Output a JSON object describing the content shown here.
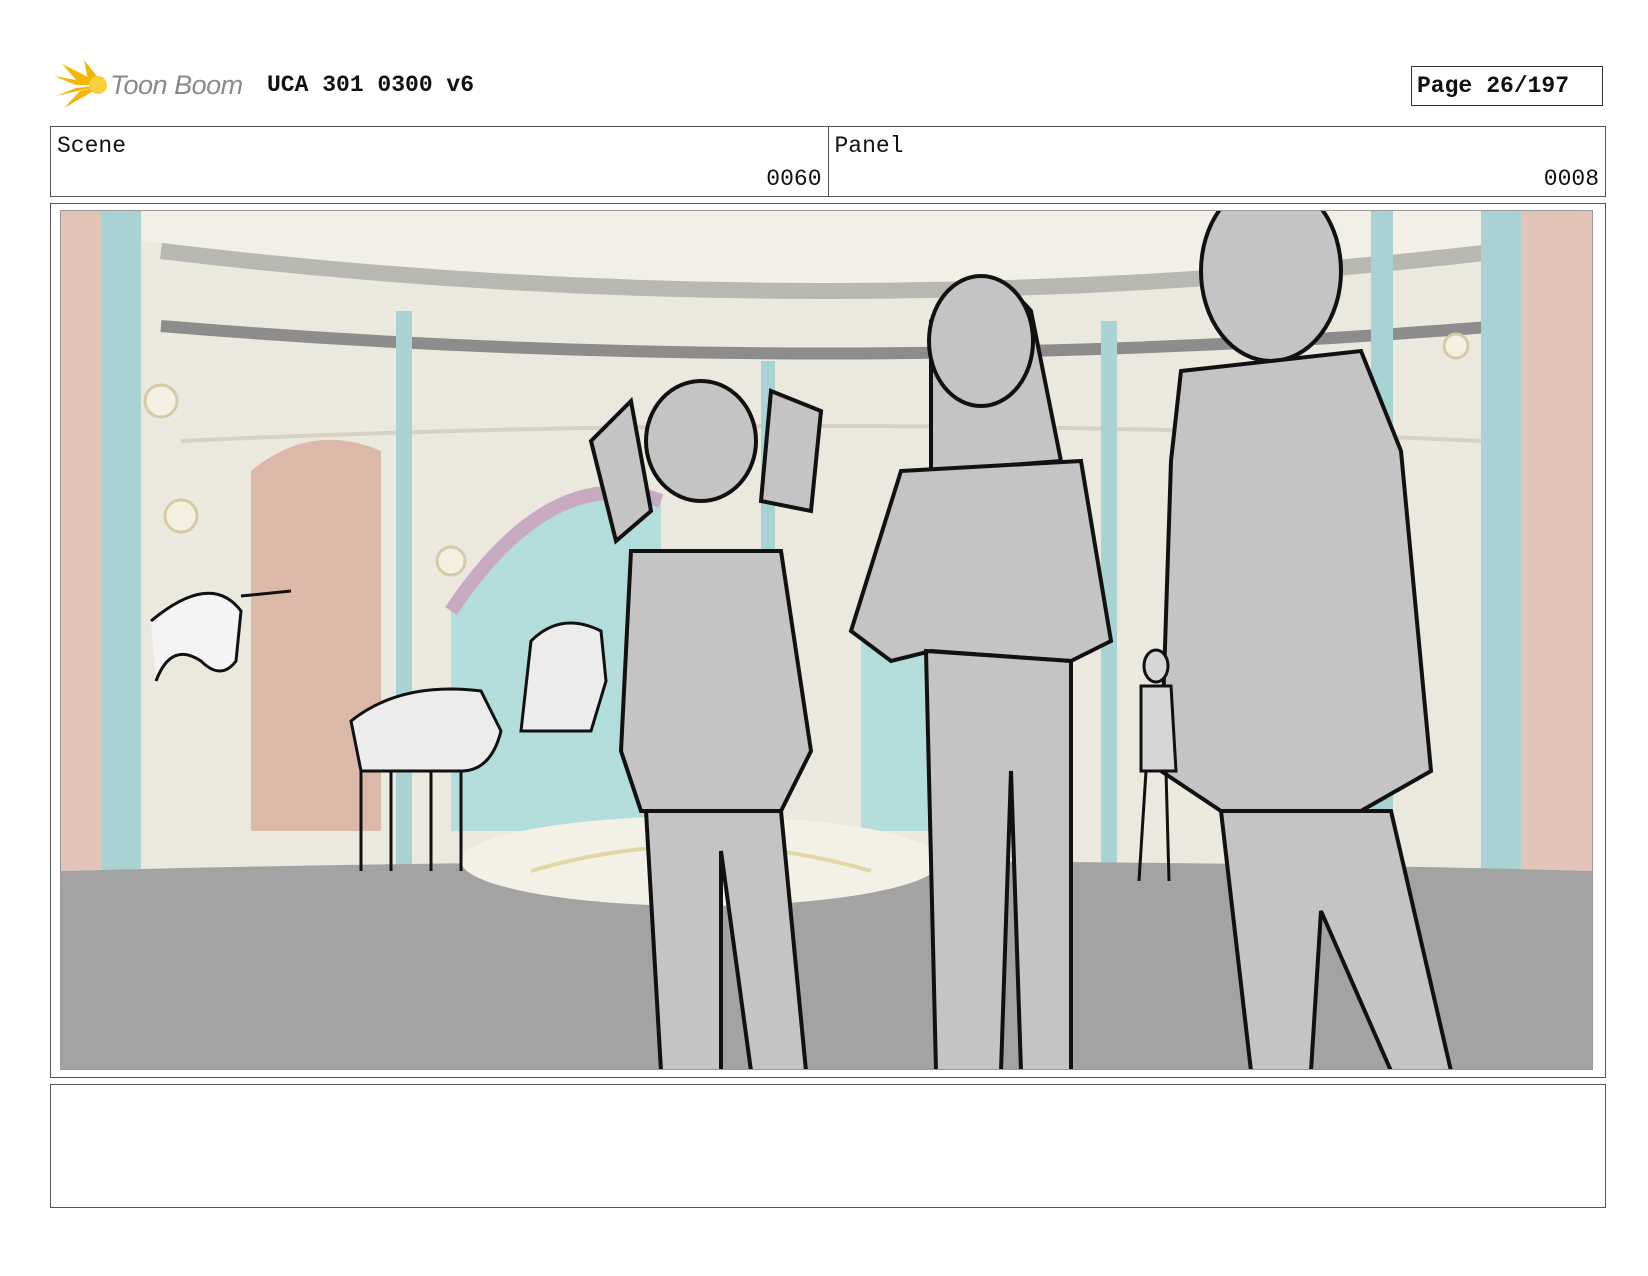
{
  "header": {
    "logo_text": "Toon Boom",
    "doc_title": "UCA 301 0300 v6",
    "page_label": "Page",
    "page_number": "26/197"
  },
  "info": {
    "scene_label": "Scene",
    "scene_value": "0060",
    "panel_label": "Panel",
    "panel_value": "0008"
  },
  "notes": {
    "text": ""
  },
  "colors": {
    "logo_yellow": "#f2b705",
    "pillar": "#a8d2d3",
    "wall": "#eae7dc",
    "floor": "#a3a3a3",
    "figure_fill": "#c4c4c4",
    "sketch_line": "#111111"
  }
}
